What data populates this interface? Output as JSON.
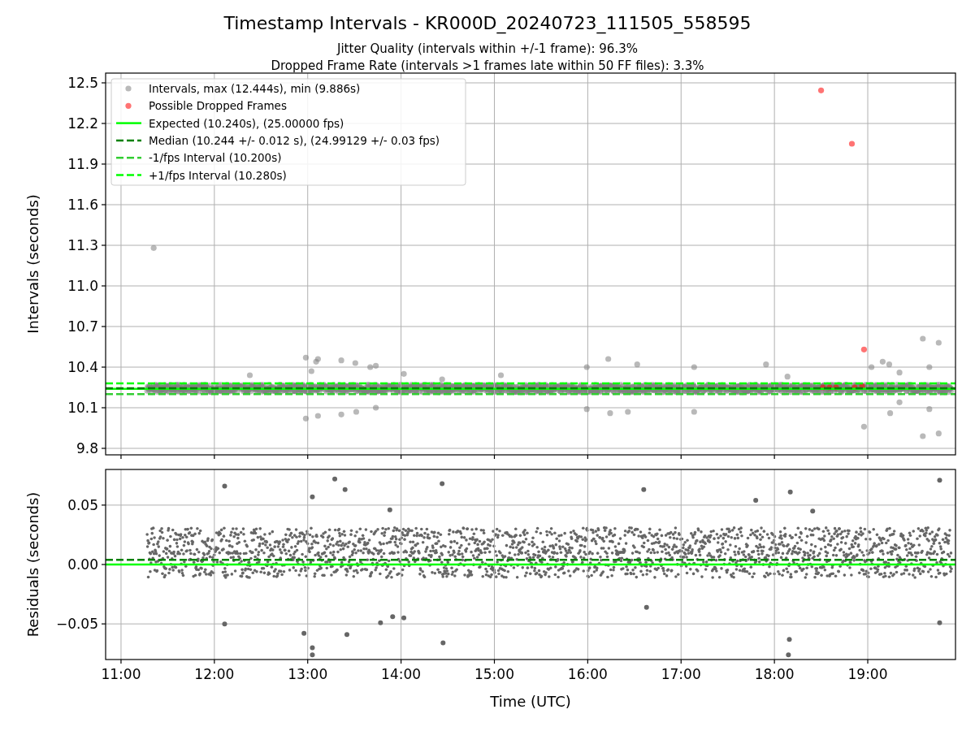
{
  "title": "Timestamp Intervals - KR000D_20240723_111505_558595",
  "subtitles": [
    "Jitter Quality (intervals within +/-1 frame): 96.3%",
    "Dropped Frame Rate (intervals >1 frames late within 50 FF files): 3.3%"
  ],
  "intervals_plot": {
    "chart_data": {
      "type": "scatter",
      "ylabel": "Intervals (seconds)",
      "xlim": [
        10.835,
        19.94
      ],
      "ylim": [
        9.752,
        12.572
      ],
      "grid": true,
      "legend": true,
      "yticks": [
        {
          "value": 9.8,
          "label": "9.8"
        },
        {
          "value": 10.1,
          "label": "10.1"
        },
        {
          "value": 10.4,
          "label": "10.4"
        },
        {
          "value": 10.7,
          "label": "10.7"
        },
        {
          "value": 11.0,
          "label": "11.0"
        },
        {
          "value": 11.3,
          "label": "11.3"
        },
        {
          "value": 11.6,
          "label": "11.6"
        },
        {
          "value": 11.9,
          "label": "11.9"
        },
        {
          "value": 12.2,
          "label": "12.2"
        },
        {
          "value": 12.5,
          "label": "12.5"
        }
      ],
      "series": [
        {
          "name": "Intervals, max (12.444s), min (9.886s)",
          "color": "#808080",
          "x": [
            11.35,
            12.38,
            12.98,
            12.98,
            13.04,
            13.09,
            13.11,
            13.11,
            13.36,
            13.36,
            13.51,
            13.52,
            13.67,
            13.73,
            13.73,
            14.03,
            14.44,
            15.07,
            15.99,
            15.99,
            16.22,
            16.24,
            16.43,
            16.53,
            17.14,
            17.14,
            17.91,
            18.14,
            18.96,
            19.04,
            19.16,
            19.23,
            19.24,
            19.34,
            19.34,
            19.59,
            19.59,
            19.66,
            19.66,
            19.76,
            19.76
          ],
          "values": [
            11.28,
            10.34,
            10.47,
            10.02,
            10.37,
            10.44,
            10.46,
            10.04,
            10.45,
            10.05,
            10.43,
            10.07,
            10.4,
            10.41,
            10.1,
            10.35,
            10.31,
            10.34,
            10.4,
            10.09,
            10.46,
            10.06,
            10.07,
            10.42,
            10.4,
            10.07,
            10.42,
            10.33,
            9.96,
            10.4,
            10.44,
            10.42,
            10.06,
            10.36,
            10.14,
            10.61,
            9.89,
            10.4,
            10.09,
            10.58,
            9.91
          ]
        },
        {
          "name": "Possible Dropped Frames",
          "color": "#ff0000",
          "x": [
            18.5,
            18.83,
            18.96,
            18.52,
            18.59,
            18.66,
            18.86,
            18.94
          ],
          "values": [
            12.444,
            12.05,
            10.53,
            10.25,
            10.25,
            10.25,
            10.25,
            10.26
          ]
        }
      ],
      "ref_lines": [
        {
          "axis": "y",
          "value": 10.24,
          "label": "Expected (10.240s), (25.00000 fps)",
          "color": "#00ff00"
        },
        {
          "axis": "y",
          "value": 10.244,
          "label": "Median (10.244 +/- 0.012 s), (24.99129 +/- 0.03 fps)",
          "color": "#008000"
        },
        {
          "axis": "y",
          "value": 10.2,
          "label": "-1/fps Interval (10.200s)",
          "color": "#32cd32"
        },
        {
          "axis": "y",
          "value": 10.28,
          "label": "+1/fps Interval (10.280s)",
          "color": "#00ff00"
        }
      ]
    }
  },
  "residuals_plot": {
    "chart_data": {
      "type": "scatter",
      "xlabel": "Time (UTC)",
      "ylabel": "Residuals (seconds)",
      "xlim": [
        10.835,
        19.94
      ],
      "ylim": [
        -0.08,
        0.08
      ],
      "grid": true,
      "xticks": [
        {
          "value": 11,
          "label": "11:00"
        },
        {
          "value": 12,
          "label": "12:00"
        },
        {
          "value": 13,
          "label": "13:00"
        },
        {
          "value": 14,
          "label": "14:00"
        },
        {
          "value": 15,
          "label": "15:00"
        },
        {
          "value": 16,
          "label": "16:00"
        },
        {
          "value": 17,
          "label": "17:00"
        },
        {
          "value": 18,
          "label": "18:00"
        },
        {
          "value": 19,
          "label": "19:00"
        }
      ],
      "yticks": [
        {
          "value": -0.05,
          "label": "−0.05"
        },
        {
          "value": 0,
          "label": "0.00"
        },
        {
          "value": 0.05,
          "label": "0.05"
        }
      ],
      "series": [
        {
          "color": "#666666",
          "x": [
            12.11,
            12.11,
            12.96,
            13.05,
            13.05,
            13.05,
            13.29,
            13.4,
            13.42,
            13.78,
            13.88,
            13.91,
            14.03,
            14.44,
            14.45,
            16.6,
            16.63,
            17.8,
            18.15,
            18.16,
            18.17,
            18.41,
            19.77,
            19.77
          ],
          "values": [
            0.066,
            -0.05,
            -0.058,
            0.057,
            -0.07,
            -0.076,
            0.072,
            0.063,
            -0.059,
            -0.049,
            0.046,
            -0.044,
            -0.045,
            0.068,
            -0.066,
            0.063,
            -0.036,
            0.054,
            -0.076,
            -0.063,
            0.061,
            0.045,
            0.071,
            -0.049
          ]
        }
      ],
      "ref_lines": [
        {
          "axis": "y",
          "value": 0,
          "color": "#00ff00"
        },
        {
          "axis": "y",
          "value": 0.004,
          "color": "#008000"
        }
      ]
    }
  }
}
